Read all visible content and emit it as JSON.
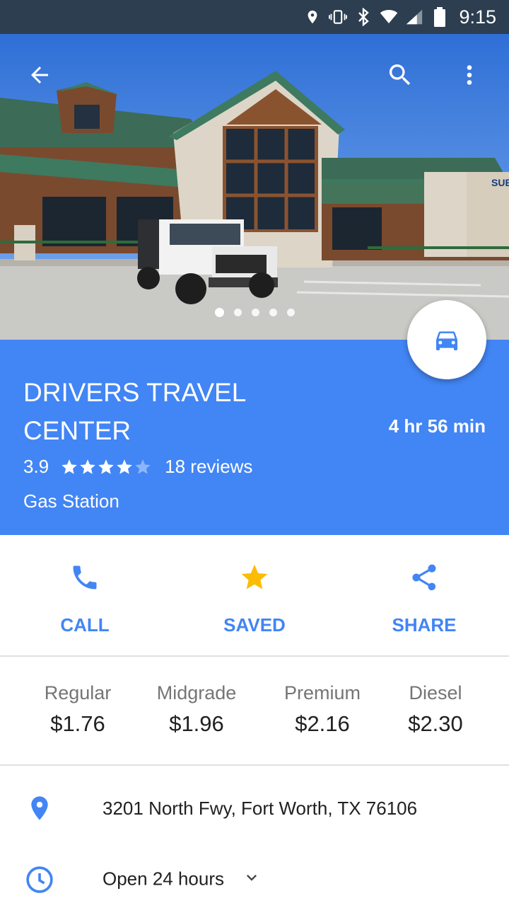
{
  "status_bar": {
    "time": "9:15"
  },
  "hero": {
    "photo_count": 5,
    "active_photo": 1
  },
  "place": {
    "name": "DRIVERS TRAVEL CENTER",
    "drive_time": "4 hr 56 min",
    "rating": "3.9",
    "stars_filled": 4,
    "stars_total": 5,
    "reviews": "18 reviews",
    "category": "Gas Station"
  },
  "actions": {
    "call": "CALL",
    "saved": "SAVED",
    "share": "SHARE"
  },
  "gas_prices": [
    {
      "grade": "Regular",
      "price": "$1.76"
    },
    {
      "grade": "Midgrade",
      "price": "$1.96"
    },
    {
      "grade": "Premium",
      "price": "$2.16"
    },
    {
      "grade": "Diesel",
      "price": "$2.30"
    }
  ],
  "details": {
    "address": "3201 North Fwy, Fort Worth, TX 76106",
    "hours": "Open 24 hours"
  },
  "colors": {
    "header_blue": "#4285f4",
    "accent_blue": "#4285f4",
    "star_saved": "#fbbc04",
    "status_bar": "#2c3e50"
  }
}
